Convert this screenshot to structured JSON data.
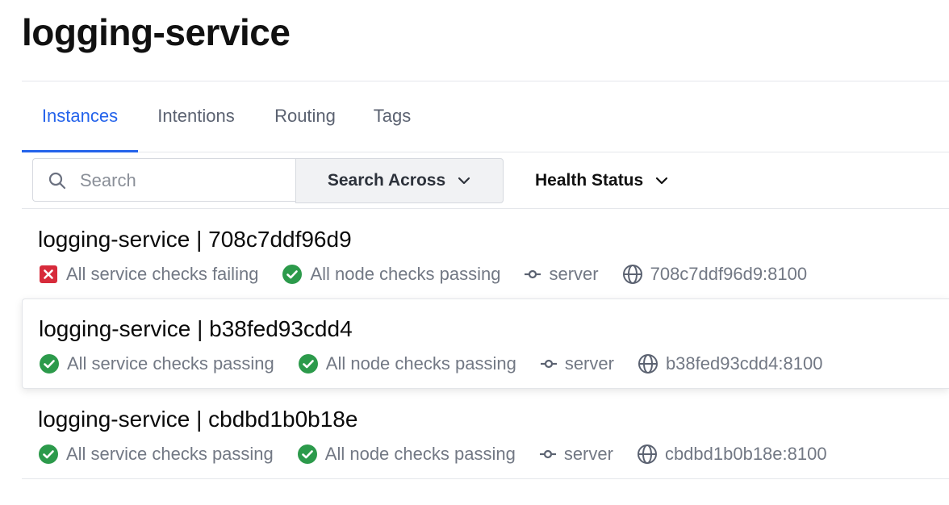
{
  "page": {
    "title": "logging-service"
  },
  "tabs": [
    {
      "label": "Instances",
      "active": true
    },
    {
      "label": "Intentions",
      "active": false
    },
    {
      "label": "Routing",
      "active": false
    },
    {
      "label": "Tags",
      "active": false
    }
  ],
  "toolbar": {
    "search_placeholder": "Search",
    "search_value": "",
    "search_across_label": "Search Across",
    "health_status_label": "Health Status"
  },
  "colors": {
    "accent": "#2463eb",
    "passing": "#2c9a4b",
    "failing": "#d72b3b",
    "muted_text": "#727884"
  },
  "instances": [
    {
      "title": "logging-service | 708c7ddf96d9",
      "service_check": {
        "status": "failing",
        "icon": "x-square-icon",
        "label": "All service checks failing"
      },
      "node_check": {
        "status": "passing",
        "icon": "check-circle-icon",
        "label": "All node checks passing"
      },
      "node": {
        "icon": "git-commit-icon",
        "label": "server"
      },
      "address": {
        "icon": "globe-icon",
        "label": "708c7ddf96d9:8100"
      }
    },
    {
      "title": "logging-service | b38fed93cdd4",
      "service_check": {
        "status": "passing",
        "icon": "check-circle-icon",
        "label": "All service checks passing"
      },
      "node_check": {
        "status": "passing",
        "icon": "check-circle-icon",
        "label": "All node checks passing"
      },
      "node": {
        "icon": "git-commit-icon",
        "label": "server"
      },
      "address": {
        "icon": "globe-icon",
        "label": "b38fed93cdd4:8100"
      }
    },
    {
      "title": "logging-service | cbdbd1b0b18e",
      "service_check": {
        "status": "passing",
        "icon": "check-circle-icon",
        "label": "All service checks passing"
      },
      "node_check": {
        "status": "passing",
        "icon": "check-circle-icon",
        "label": "All node checks passing"
      },
      "node": {
        "icon": "git-commit-icon",
        "label": "server"
      },
      "address": {
        "icon": "globe-icon",
        "label": "cbdbd1b0b18e:8100"
      }
    }
  ]
}
